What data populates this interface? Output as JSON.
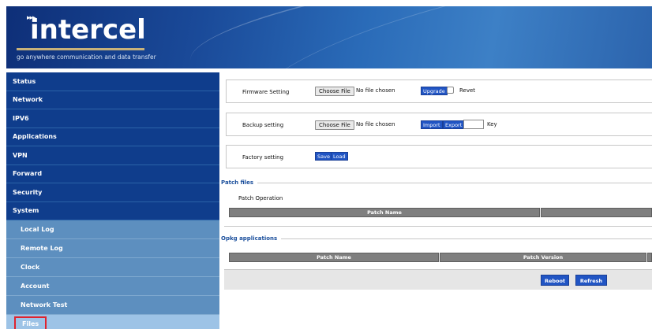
{
  "header": {
    "brand": "intercel",
    "arrows": "▸▸▸",
    "tagline": "go anywhere communication and data transfer"
  },
  "sidebar": {
    "items": [
      {
        "label": "Status"
      },
      {
        "label": "Network"
      },
      {
        "label": "IPV6"
      },
      {
        "label": "Applications"
      },
      {
        "label": "VPN"
      },
      {
        "label": "Forward"
      },
      {
        "label": "Security"
      },
      {
        "label": "System"
      }
    ],
    "subitems": [
      {
        "label": "Local Log"
      },
      {
        "label": "Remote Log"
      },
      {
        "label": "Clock"
      },
      {
        "label": "Account"
      },
      {
        "label": "Network Test"
      },
      {
        "label": "Files",
        "active": true
      }
    ]
  },
  "firmware": {
    "label": "Firmware Setting",
    "choose": "Choose File",
    "nofile": "No file chosen",
    "upgrade": "Upgrade",
    "revet": "Revet"
  },
  "backup": {
    "label": "Backup setting",
    "choose": "Choose File",
    "nofile": "No file chosen",
    "import": "Import",
    "export": "Export",
    "key": "Key"
  },
  "factory": {
    "label": "Factory setting",
    "save": "Save",
    "load": "Load"
  },
  "patch": {
    "legend": "Patch files",
    "operation": "Patch Operation",
    "columns": [
      "Patch Name",
      ""
    ]
  },
  "opkg": {
    "legend": "Opkg applications",
    "columns": [
      "Patch Name",
      "Patch Version",
      ""
    ]
  },
  "actions": {
    "reboot": "Reboot",
    "refresh": "Refresh"
  },
  "colors": {
    "nav_bg": "#0f3d8c",
    "sub_bg": "#5d8fbf",
    "active_bg": "#9dc3e6",
    "button": "#2155c4"
  }
}
